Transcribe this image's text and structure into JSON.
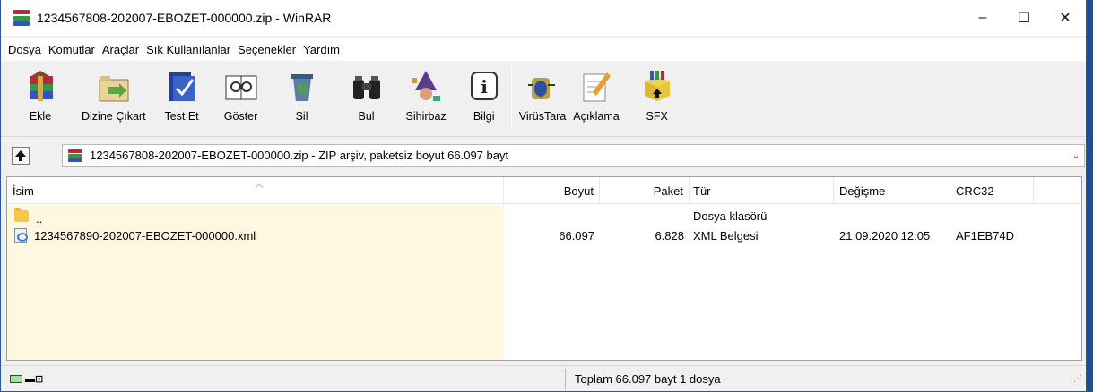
{
  "window": {
    "title": "1234567808-202007-EBOZET-000000.zip - WinRAR",
    "controls": {
      "minimize": "–",
      "maximize": "☐",
      "close": "✕"
    }
  },
  "menu": [
    "Dosya",
    "Komutlar",
    "Araçlar",
    "Sık Kullanılanlar",
    "Seçenekler",
    "Yardım"
  ],
  "toolbar": {
    "add": "Ekle",
    "extract": "Dizine Çıkart",
    "test": "Test Et",
    "view": "Göster",
    "delete": "Sil",
    "find": "Bul",
    "wizard": "Sihirbaz",
    "info": "Bilgi",
    "virus": "VirüsTara",
    "comment": "Açıklama",
    "sfx": "SFX"
  },
  "address": {
    "path": "1234567808-202007-EBOZET-000000.zip - ZIP arşiv, paketsiz boyut 66.097 bayt"
  },
  "columns": {
    "name": "İsim",
    "size": "Boyut",
    "packed": "Paket",
    "type": "Tür",
    "modified": "Değişme",
    "crc": "CRC32"
  },
  "files": [
    {
      "name": "..",
      "size": "",
      "packed": "",
      "type": "Dosya klasörü",
      "modified": "",
      "crc": ""
    },
    {
      "name": "1234567890-202007-EBOZET-000000.xml",
      "size": "66.097",
      "packed": "6.828",
      "type": "XML Belgesi",
      "modified": "21.09.2020 12:05",
      "crc": "AF1EB74D"
    }
  ],
  "status": {
    "summary": "Toplam 66.097 bayt 1 dosya"
  },
  "colors": {
    "accent": "#2b5797",
    "name_column_shade": "#fff7e0"
  }
}
